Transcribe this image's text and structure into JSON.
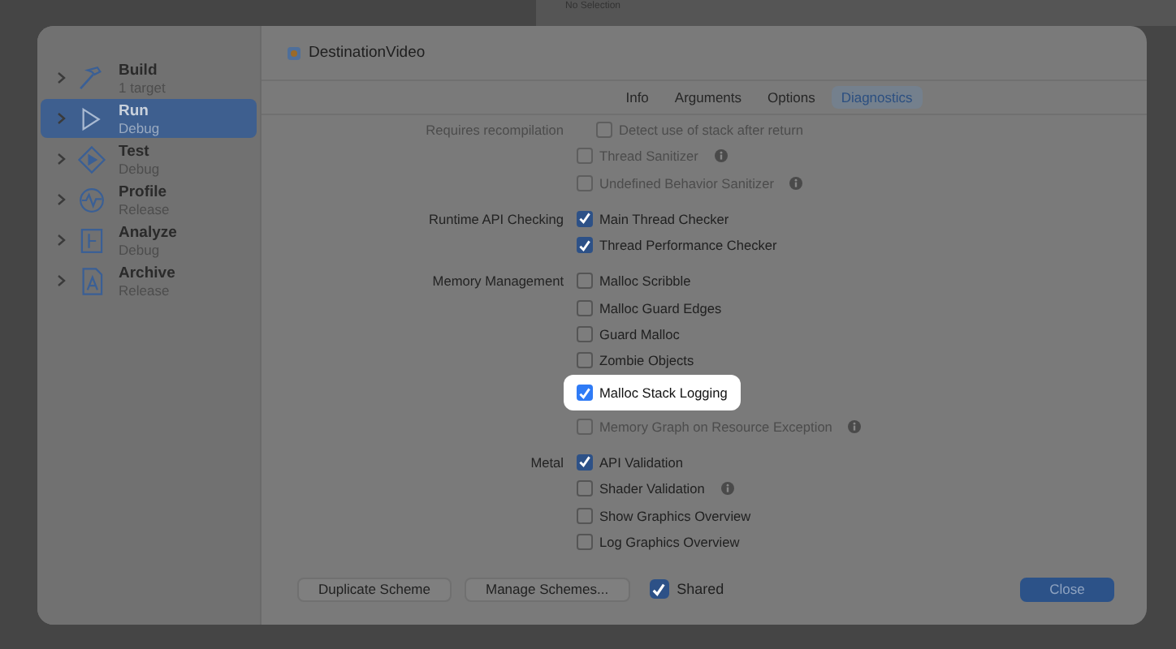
{
  "background": {
    "text": "No Selection"
  },
  "sidebar": {
    "items": [
      {
        "kind": "build",
        "title": "Build",
        "subtitle": "1 target",
        "selected": false
      },
      {
        "kind": "run",
        "title": "Run",
        "subtitle": "Debug",
        "selected": true
      },
      {
        "kind": "test",
        "title": "Test",
        "subtitle": "Debug",
        "selected": false
      },
      {
        "kind": "profile",
        "title": "Profile",
        "subtitle": "Release",
        "selected": false
      },
      {
        "kind": "analyze",
        "title": "Analyze",
        "subtitle": "Debug",
        "selected": false
      },
      {
        "kind": "archive",
        "title": "Archive",
        "subtitle": "Release",
        "selected": false
      }
    ]
  },
  "scheme": {
    "name": "DestinationVideo"
  },
  "tabs": [
    {
      "label": "Info",
      "selected": false
    },
    {
      "label": "Arguments",
      "selected": false
    },
    {
      "label": "Options",
      "selected": false
    },
    {
      "label": "Diagnostics",
      "selected": true
    }
  ],
  "sections": [
    {
      "label": "Requires recompilation",
      "label_disabled": true,
      "options": [
        {
          "kind": "suboption",
          "text": "Detect use of stack after return",
          "checked": false,
          "disabled": true,
          "highlighted": false
        },
        {
          "kind": "option",
          "text": "Thread Sanitizer",
          "checked": false,
          "disabled": true,
          "info": true,
          "highlighted": false
        },
        {
          "kind": "option",
          "text": "Undefined Behavior Sanitizer",
          "checked": false,
          "disabled": true,
          "info": true,
          "highlighted": false
        }
      ]
    },
    {
      "label": "Runtime API Checking",
      "label_disabled": false,
      "options": [
        {
          "kind": "option",
          "text": "Main Thread Checker",
          "checked": true,
          "disabled": false,
          "highlighted": false
        },
        {
          "kind": "option",
          "text": "Thread Performance Checker",
          "checked": true,
          "disabled": false,
          "highlighted": false
        }
      ]
    },
    {
      "label": "Memory Management",
      "label_disabled": false,
      "options": [
        {
          "kind": "option",
          "text": "Malloc Scribble",
          "checked": false,
          "disabled": false,
          "highlighted": false
        },
        {
          "kind": "option",
          "text": "Malloc Guard Edges",
          "checked": false,
          "disabled": false,
          "highlighted": false
        },
        {
          "kind": "option",
          "text": "Guard Malloc",
          "checked": false,
          "disabled": false,
          "highlighted": false
        },
        {
          "kind": "option",
          "text": "Zombie Objects",
          "checked": false,
          "disabled": false,
          "highlighted": false
        },
        {
          "kind": "option",
          "text": "Malloc Stack Logging",
          "checked": true,
          "disabled": false,
          "highlighted": true
        },
        {
          "kind": "option",
          "text": "Memory Graph on Resource Exception",
          "checked": false,
          "disabled": true,
          "info": true,
          "highlighted": false
        }
      ]
    },
    {
      "label": "Metal",
      "label_disabled": false,
      "options": [
        {
          "kind": "option",
          "text": "API Validation",
          "checked": true,
          "disabled": false,
          "highlighted": false
        },
        {
          "kind": "option",
          "text": "Shader Validation",
          "checked": false,
          "disabled": false,
          "info": true,
          "highlighted": false
        },
        {
          "kind": "option",
          "text": "Show Graphics Overview",
          "checked": false,
          "disabled": false,
          "highlighted": false
        },
        {
          "kind": "option",
          "text": "Log Graphics Overview",
          "checked": false,
          "disabled": false,
          "highlighted": false
        }
      ]
    }
  ],
  "footer": {
    "buttons": [
      {
        "label": "Duplicate Scheme"
      },
      {
        "label": "Manage Schemes..."
      }
    ],
    "shared": {
      "label": "Shared",
      "checked": true
    },
    "close": {
      "label": "Close"
    }
  }
}
